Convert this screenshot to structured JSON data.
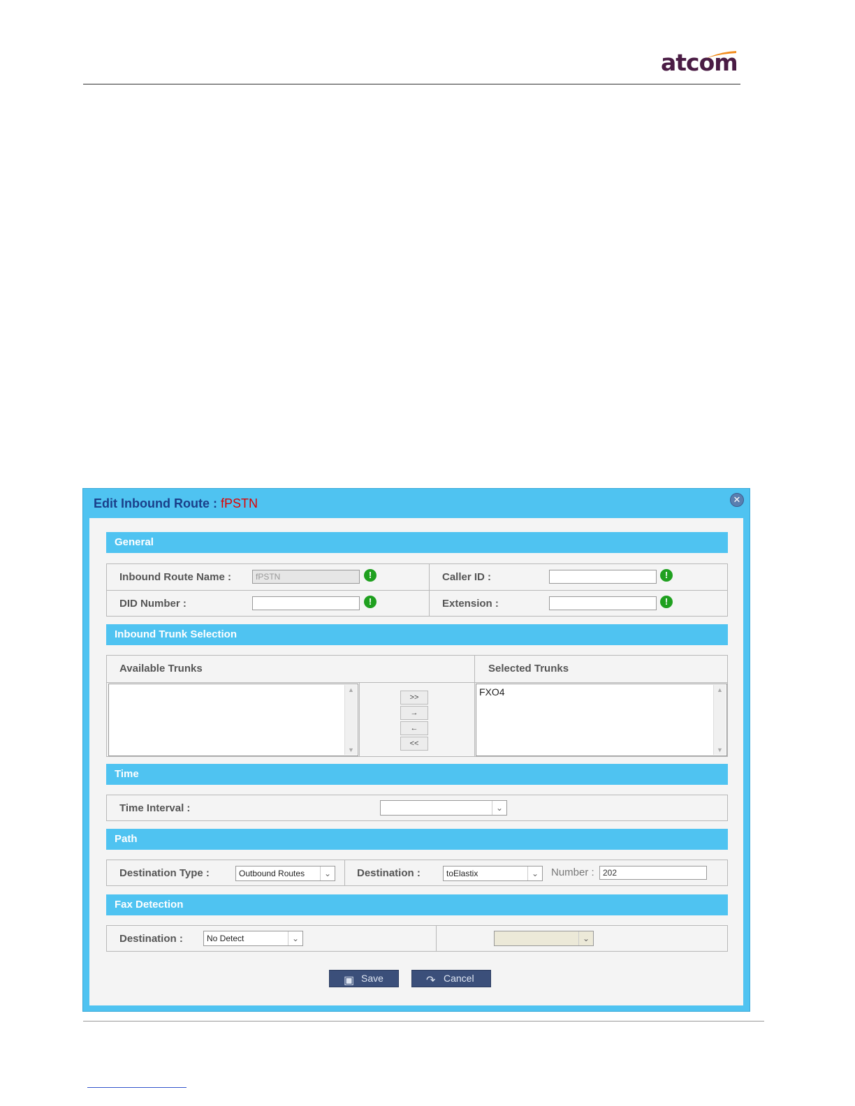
{
  "header": {
    "logo_text": "atcom"
  },
  "dialog": {
    "title": "Edit Inbound Route :",
    "route_name": "fPSTN",
    "close_icon": "close-icon",
    "sections": {
      "general": "General",
      "trunk": "Inbound Trunk Selection",
      "time": "Time",
      "path": "Path",
      "fax": "Fax Detection"
    },
    "general": {
      "route_name_label": "Inbound Route Name :",
      "route_name_value": "fPSTN",
      "caller_id_label": "Caller ID :",
      "caller_id_value": "",
      "did_label": "DID Number :",
      "did_value": "",
      "extension_label": "Extension :",
      "extension_value": ""
    },
    "trunks": {
      "available_label": "Available Trunks",
      "selected_label": "Selected Trunks",
      "available": [],
      "selected": [
        "FXO4"
      ],
      "buttons": [
        ">>",
        "→",
        "←",
        "<<"
      ]
    },
    "time": {
      "interval_label": "Time Interval :",
      "interval_value": ""
    },
    "path": {
      "dest_type_label": "Destination Type :",
      "dest_type_value": "Outbound Routes",
      "destination_label": "Destination :",
      "destination_value": "toElastix",
      "number_label": "Number :",
      "number_value": "202"
    },
    "fax": {
      "destination_label": "Destination :",
      "destination_value": "No Detect",
      "second_value": ""
    },
    "actions": {
      "save": "Save",
      "cancel": "Cancel"
    },
    "colors": {
      "header_bg": "#4fc3f1",
      "title": "#1a3f8a",
      "route_name": "#e00000",
      "button_bg": "#3b4f7a"
    }
  }
}
